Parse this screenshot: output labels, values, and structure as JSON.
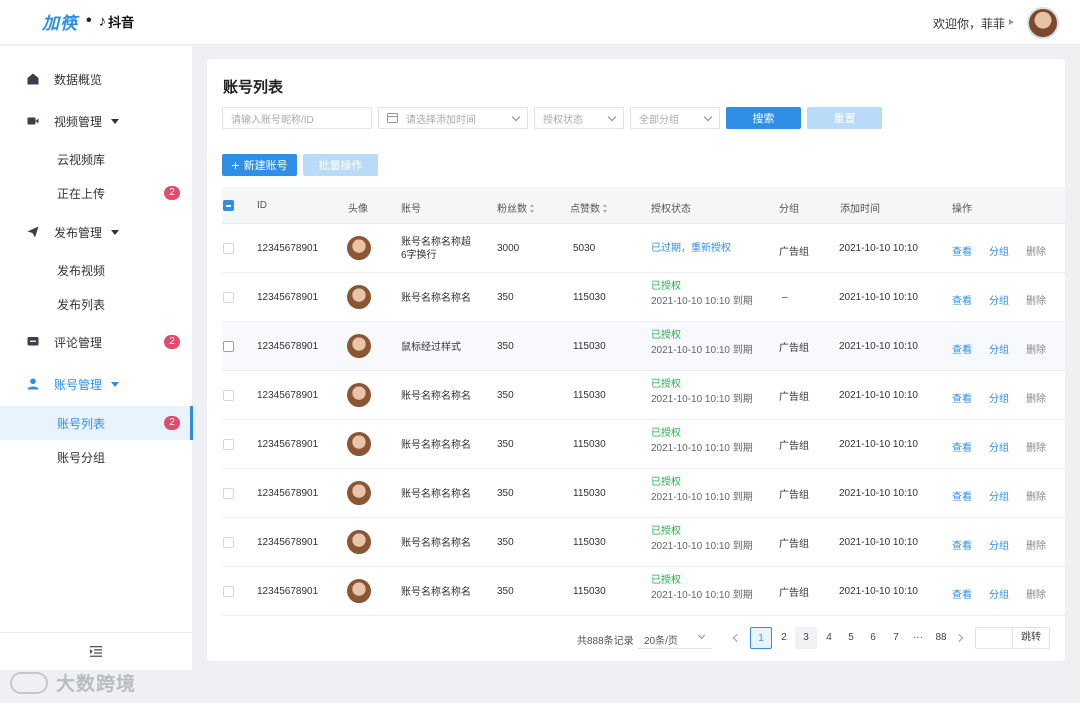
{
  "header": {
    "brand": "加筷",
    "platform_icon": "tiktok-note-icon",
    "platform": "抖音",
    "welcome": "欢迎你，菲菲"
  },
  "sidebar": {
    "items": [
      {
        "label": "数据概览",
        "icon": "home-icon"
      },
      {
        "label": "视频管理",
        "icon": "video-icon",
        "expandable": true
      },
      {
        "label": "云视频库",
        "sub": true
      },
      {
        "label": "正在上传",
        "sub": true,
        "badge": "2"
      },
      {
        "label": "发布管理",
        "icon": "send-icon",
        "expandable": true
      },
      {
        "label": "发布视频",
        "sub": true
      },
      {
        "label": "发布列表",
        "sub": true
      },
      {
        "label": "评论管理",
        "icon": "comment-icon",
        "badge": "2"
      },
      {
        "label": "账号管理",
        "icon": "user-icon",
        "expandable": true,
        "active_group": true
      },
      {
        "label": "账号列表",
        "sub": true,
        "badge": "2",
        "active": true
      },
      {
        "label": "账号分组",
        "sub": true
      }
    ],
    "collapse_icon": "collapse-menu-icon"
  },
  "watermark": "大数跨境",
  "main": {
    "title": "账号列表",
    "filters": {
      "search_placeholder": "请输入账号昵称/ID",
      "date_placeholder": "请选择添加时间",
      "auth_placeholder": "授权状态",
      "group_placeholder": "全部分组",
      "search_button": "搜索",
      "reset_button": "重置"
    },
    "actions": {
      "new_account": "新建账号",
      "batch": "批量操作"
    },
    "table": {
      "headers": {
        "id": "ID",
        "avatar": "头像",
        "account": "账号",
        "fans": "粉丝数",
        "likes": "点赞数",
        "auth": "授权状态",
        "group": "分组",
        "added": "添加时间",
        "ops": "操作"
      },
      "ops": {
        "view": "查看",
        "group": "分组",
        "delete": "删除"
      },
      "rows": [
        {
          "id": "12345678901",
          "account": "账号名称名称超6字换行",
          "fans": "3000",
          "likes": "5030",
          "auth_status": "已过期，重新授权",
          "auth_until": "",
          "group": "广告组",
          "added": "2021-10-10 10:10"
        },
        {
          "id": "12345678901",
          "account": "账号名称名称名",
          "fans": "350",
          "likes": "115030",
          "auth_status": "已授权",
          "auth_until": "2021-10-10 10:10 到期",
          "group": "–",
          "added": "2021-10-10 10:10"
        },
        {
          "id": "12345678901",
          "account": "鼠标经过样式",
          "fans": "350",
          "likes": "115030",
          "auth_status": "已授权",
          "auth_until": "2021-10-10 10:10 到期",
          "group": "广告组",
          "added": "2021-10-10 10:10"
        },
        {
          "id": "12345678901",
          "account": "账号名称名称名",
          "fans": "350",
          "likes": "115030",
          "auth_status": "已授权",
          "auth_until": "2021-10-10 10:10 到期",
          "group": "广告组",
          "added": "2021-10-10 10:10"
        },
        {
          "id": "12345678901",
          "account": "账号名称名称名",
          "fans": "350",
          "likes": "115030",
          "auth_status": "已授权",
          "auth_until": "2021-10-10 10:10 到期",
          "group": "广告组",
          "added": "2021-10-10 10:10"
        },
        {
          "id": "12345678901",
          "account": "账号名称名称名",
          "fans": "350",
          "likes": "115030",
          "auth_status": "已授权",
          "auth_until": "2021-10-10 10:10 到期",
          "group": "广告组",
          "added": "2021-10-10 10:10"
        },
        {
          "id": "12345678901",
          "account": "账号名称名称名",
          "fans": "350",
          "likes": "115030",
          "auth_status": "已授权",
          "auth_until": "2021-10-10 10:10 到期",
          "group": "广告组",
          "added": "2021-10-10 10:10"
        },
        {
          "id": "12345678901",
          "account": "账号名称名称名",
          "fans": "350",
          "likes": "115030",
          "auth_status": "已授权",
          "auth_until": "2021-10-10 10:10 到期",
          "group": "广告组",
          "added": "2021-10-10 10:10"
        }
      ]
    },
    "pagination": {
      "total": "共888条记录",
      "page_size": "20条/页",
      "pages": [
        "1",
        "2",
        "3",
        "4",
        "5",
        "6",
        "7",
        "···",
        "88"
      ],
      "current": "1",
      "jump": "跳转"
    }
  },
  "colors": {
    "accent": "#2f8fe6",
    "badge": "#e34b6c",
    "success": "#23b34a"
  }
}
